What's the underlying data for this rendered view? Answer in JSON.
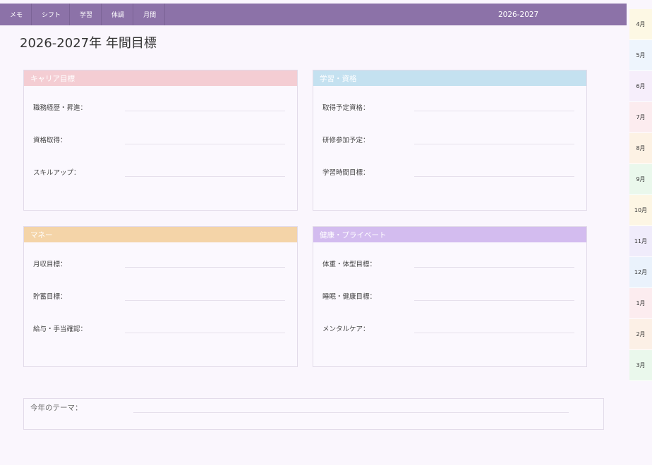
{
  "nav": {
    "tabs": [
      "メモ",
      "シフト",
      "学習",
      "体調",
      "月間"
    ],
    "year": "2026-2027"
  },
  "page_title": "2026-2027年 年間目標",
  "colors": {
    "header_bar": "#8c72a8",
    "career": "#f4cdd3",
    "study": "#c4e1f0",
    "money": "#f4d4a8",
    "health": "#d3bcef"
  },
  "cards": [
    {
      "id": "career",
      "title": "キャリア目標",
      "fields": [
        "職務経歴・昇進：",
        "資格取得：",
        "スキルアップ："
      ]
    },
    {
      "id": "study",
      "title": "学習・資格",
      "fields": [
        "取得予定資格：",
        "研修参加予定：",
        "学習時間目標："
      ]
    },
    {
      "id": "money",
      "title": "マネー",
      "fields": [
        "月収目標：",
        "貯蓄目標：",
        "給与・手当確認："
      ]
    },
    {
      "id": "health",
      "title": "健康・プライベート",
      "fields": [
        "体重・体型目標：",
        "睡眠・健康目標：",
        "メンタルケア："
      ]
    }
  ],
  "theme": {
    "label": "今年のテーマ："
  },
  "months": [
    {
      "label": "4月",
      "color": "#fdf8e4"
    },
    {
      "label": "5月",
      "color": "#eef5fd"
    },
    {
      "label": "6月",
      "color": "#f6eefb"
    },
    {
      "label": "7月",
      "color": "#fcecef"
    },
    {
      "label": "8月",
      "color": "#fdf2e4"
    },
    {
      "label": "9月",
      "color": "#eaf8ec"
    },
    {
      "label": "10月",
      "color": "#fdf6e4"
    },
    {
      "label": "11月",
      "color": "#f0ecfb"
    },
    {
      "label": "12月",
      "color": "#eaf2fc"
    },
    {
      "label": "1月",
      "color": "#fcecef"
    },
    {
      "label": "2月",
      "color": "#fcf0e6"
    },
    {
      "label": "3月",
      "color": "#eaf8ec"
    }
  ]
}
